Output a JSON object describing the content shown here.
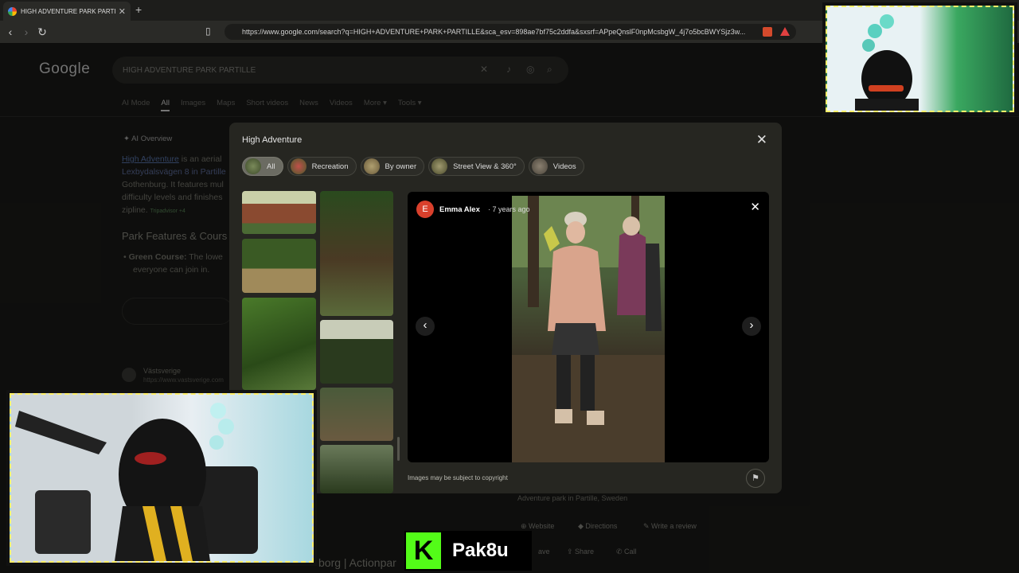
{
  "browser": {
    "tab_title": "HIGH ADVENTURE PARK PARTILLE",
    "url": "https://www.google.com/search?q=HIGH+ADVENTURE+PARK+PARTILLE&sca_esv=898ae7bf75c2ddfa&sxsrf=APpeQnslF0npMcsbgW_4j7o5bcBWYSjz3w..."
  },
  "google": {
    "logo": "Google",
    "query": "HIGH ADVENTURE PARK PARTILLE",
    "tabs": [
      "AI Mode",
      "All",
      "Images",
      "Maps",
      "Short videos",
      "News",
      "Videos",
      "More",
      "Tools"
    ],
    "ai_overview_label": "AI Overview",
    "ai_line1_link": "High Adventure",
    "ai_line1_rest": " is an aerial",
    "ai_line2": "Lexbydalsvägen 8 in Partille",
    "ai_line3": "Gothenburg. It features mul",
    "ai_line4": "difficulty levels and finishes",
    "ai_line5": "zipline.",
    "ai_line5_source": "Tripadvisor +4",
    "section_heading": "Park Features & Cours",
    "bullet_label": "Green Course:",
    "bullet_text": " The lowe",
    "bullet_text2": "everyone can join in.",
    "source_name": "Västsverige",
    "source_url": "https://www.vastsverige.com",
    "bottom_text": "Actionpar",
    "bottom_text_prefix": "borg |",
    "kp_subtitle": "Adventure park in Partille, Sweden",
    "kp_actions": [
      "Website",
      "Directions",
      "Write a review"
    ],
    "kp_actions2": [
      "ave",
      "Share",
      "Call"
    ]
  },
  "modal": {
    "title": "High Adventure",
    "chips": [
      {
        "label": "All",
        "active": true
      },
      {
        "label": "Recreation",
        "active": false
      },
      {
        "label": "By owner",
        "active": false
      },
      {
        "label": "Street View & 360°",
        "active": false
      },
      {
        "label": "Videos",
        "active": false
      }
    ],
    "viewer": {
      "avatar_letter": "E",
      "author": "Emma Alex",
      "time_ago": "· 7 years ago"
    },
    "copyright": "Images may be subject to copyright"
  },
  "overlay": {
    "stream_brand": "Pak8u",
    "stream_icon": "K"
  },
  "colors": {
    "accent": "#53fc18",
    "avatar": "#d9402c",
    "frame": "#fff06a"
  }
}
